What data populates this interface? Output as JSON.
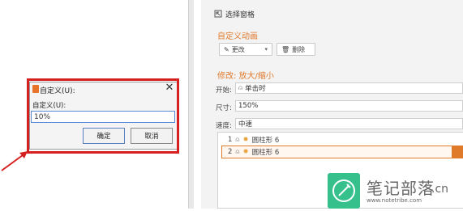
{
  "pane": {
    "title": "选择窗格",
    "section_title": "自定义动画",
    "change_label": "更改",
    "delete_label": "删除",
    "modify_label": "修改: 放大/缩小",
    "start_label": "开始:",
    "start_value": "单击时",
    "size_label": "尺寸:",
    "size_value": "150%",
    "speed_label": "速度:",
    "speed_value": "中速",
    "items": [
      {
        "index": "1",
        "name": "圆柱形 6"
      },
      {
        "index": "2",
        "name": "圆柱形 6"
      }
    ]
  },
  "dialog": {
    "title": "自定义(U):",
    "field_label": "自定义(U):",
    "field_value": "10%",
    "ok_label": "确定",
    "cancel_label": "取消"
  },
  "watermark": {
    "text": "笔记部落",
    "cn": ".cn",
    "url": "www.notetribe.com"
  },
  "colors": {
    "accent": "#e07a2b",
    "highlight_frame": "#d6201f",
    "watermark": "#35c08c"
  }
}
